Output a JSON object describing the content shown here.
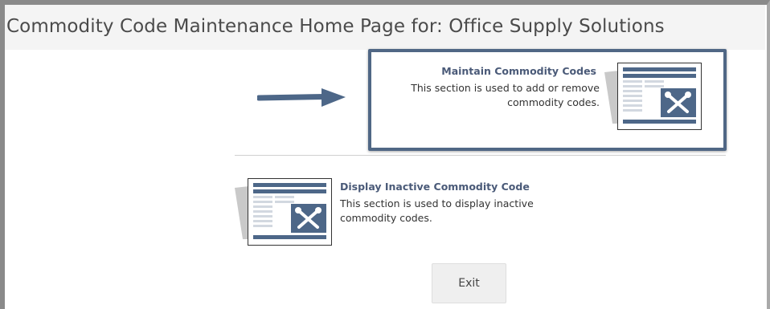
{
  "header": {
    "title": "Commodity Code Maintenance Home Page for: Office Supply Solutions"
  },
  "sections": [
    {
      "title": "Maintain Commodity Codes",
      "description": "This section is used to add or remove commodity codes.",
      "icon": "maintenance-tools-icon",
      "highlighted": true
    },
    {
      "title": "Display Inactive Commodity Code",
      "description": "This section is used to display inactive commodity codes.",
      "icon": "maintenance-tools-icon",
      "highlighted": false
    }
  ],
  "exit_button": {
    "label": "Exit"
  },
  "colors": {
    "accent": "#506785",
    "title_link": "#4a5a78",
    "header_bg": "#f4f4f4"
  }
}
